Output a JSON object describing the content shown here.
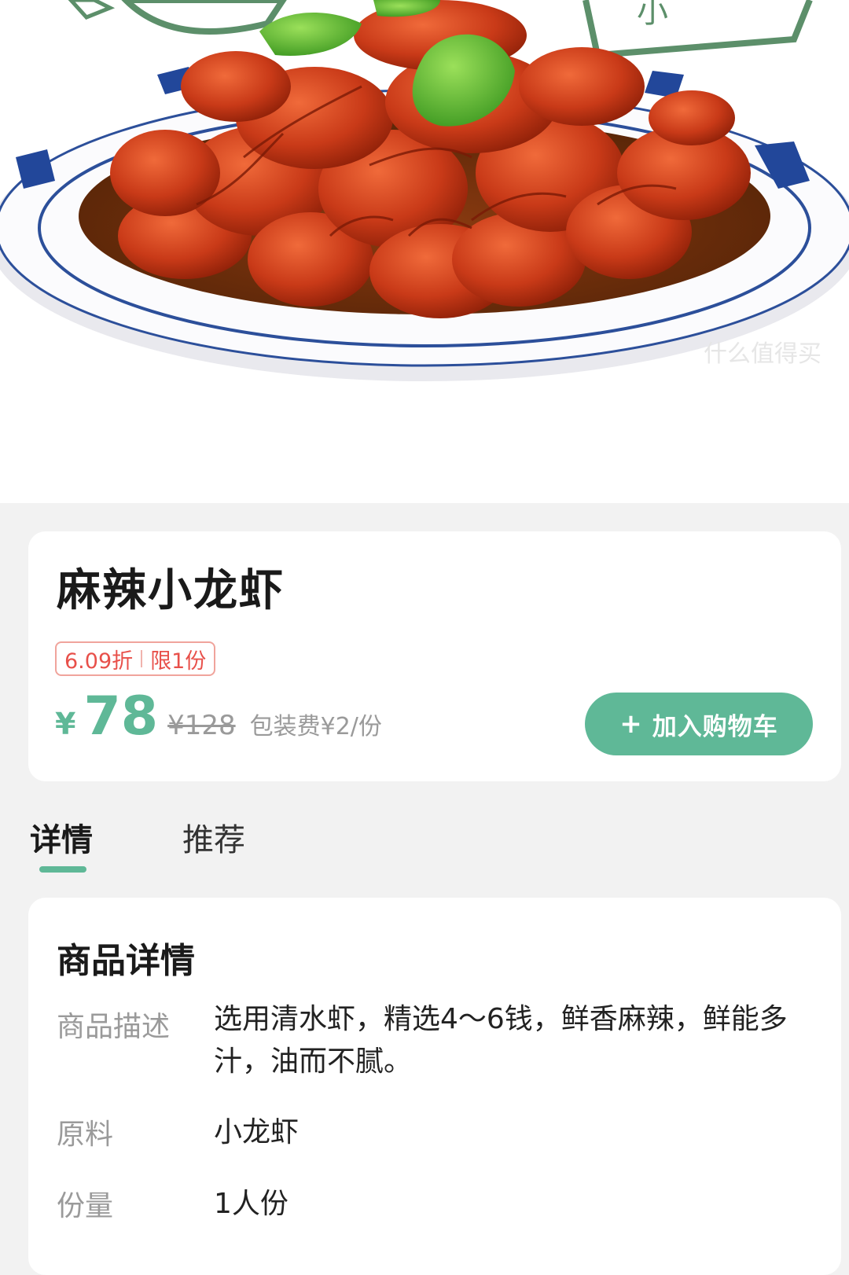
{
  "hero": {
    "image_alt": "麻辣小龙虾",
    "watermark": "什么值得买"
  },
  "product": {
    "title": "麻辣小龙虾",
    "promo": {
      "discount": "6.09折",
      "limit": "限1份"
    },
    "price": {
      "currency": "¥",
      "current": "78",
      "original": "¥128",
      "packaging_fee": "包装费¥2/份"
    },
    "add_to_cart": {
      "icon": "+",
      "label": "加入购物车"
    }
  },
  "tabs": [
    {
      "label": "详情",
      "active": true
    },
    {
      "label": "推荐",
      "active": false
    }
  ],
  "details": {
    "heading": "商品详情",
    "rows": [
      {
        "label": "商品描述",
        "value": "选用清水虾，精选4～6钱，鲜香麻辣，鲜能多汁，油而不腻。"
      },
      {
        "label": "原料",
        "value": "小龙虾"
      },
      {
        "label": "份量",
        "value": "1人份"
      }
    ]
  },
  "colors": {
    "accent": "#5fb897",
    "promo_red": "#e8504a",
    "muted": "#9a9a9a",
    "background": "#f2f2f2"
  }
}
